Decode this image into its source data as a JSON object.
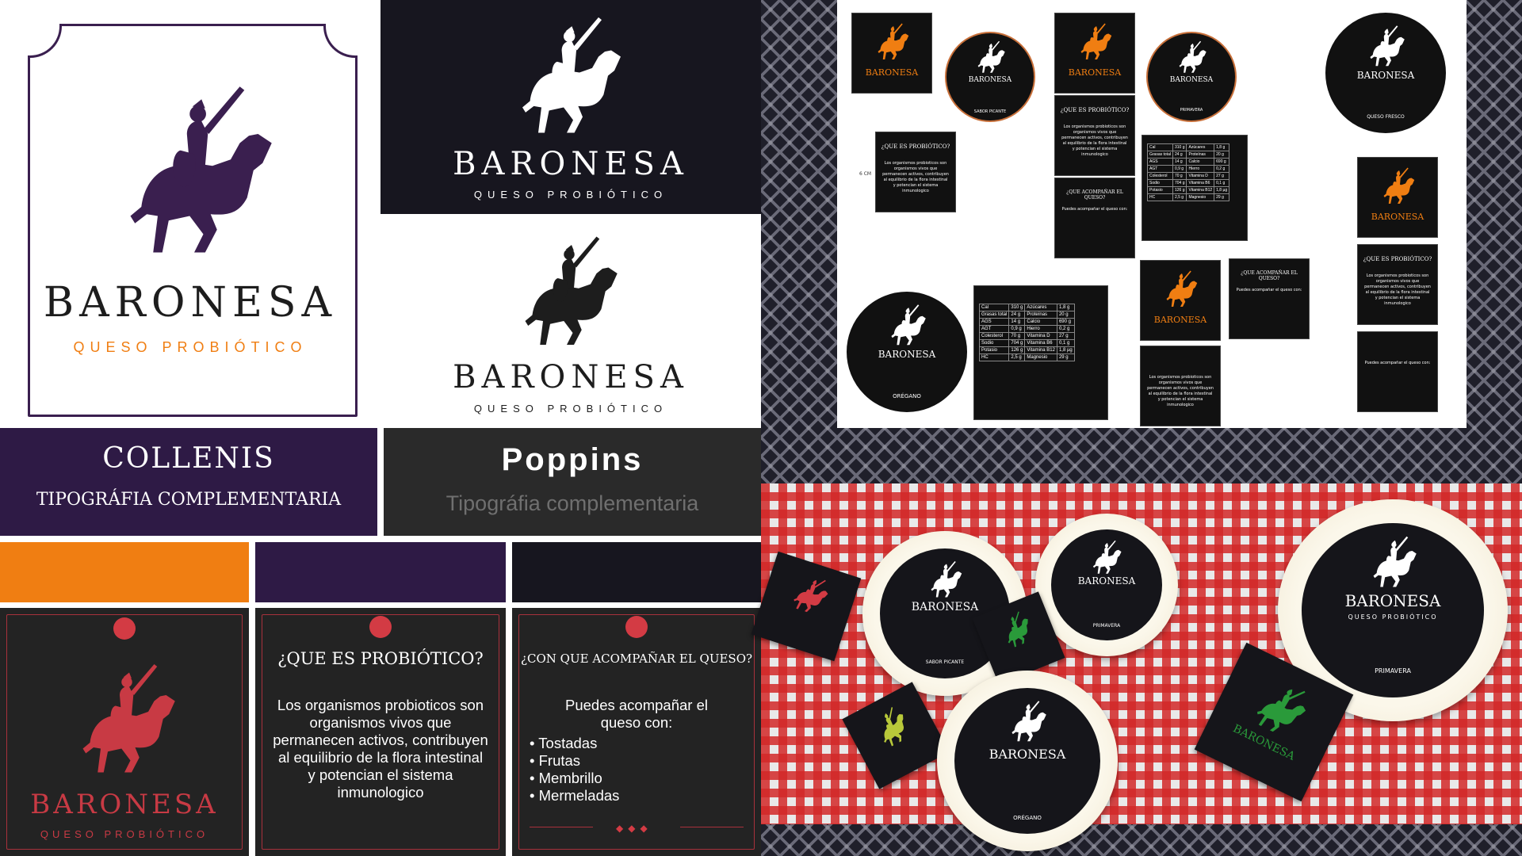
{
  "brand": {
    "name": "BARONESA",
    "tagline": "QUESO PROBIÓTICO"
  },
  "typography": {
    "collenis": {
      "name": "COLLENIS",
      "desc": "TIPOGRÁFIA COMPLEMENTARIA"
    },
    "poppins": {
      "name": "Poppins",
      "desc": "Tipográfia complementaria"
    }
  },
  "palette": [
    "#f07e12",
    "#2e1a45",
    "#17161f"
  ],
  "cards": {
    "probiotic": {
      "title": "¿QUE ES PROBIÓTICO?",
      "body": "Los organismos probioticos son organismos vivos que permanecen activos, contribuyen al equilibrio de la flora intestinal y potencian el sistema inmunologico"
    },
    "pairing": {
      "title": "¿CON QUE ACOMPAÑAR EL QUESO?",
      "intro": "Puedes acompañar el queso con:",
      "items": [
        "Tostadas",
        "Frutas",
        "Membrillo",
        "Mermeladas"
      ]
    }
  },
  "labels_sheet": {
    "flavors": [
      "SABOR PICANTE",
      "PRIMAVERA",
      "QUESO FRESCO",
      "ORÉGANO"
    ],
    "probiotic_title_small": "¿QUE ES PROBIÓTICO?",
    "pairing_title_small": "¿QUE ACOMPAÑAR EL QUESO?",
    "nutrition": [
      [
        "Cal",
        "310 g",
        "Azúcares",
        "1,8 g"
      ],
      [
        "Grasas total",
        "24 g",
        "Proteínas",
        "20 g"
      ],
      [
        "AGS",
        "14 g",
        "Calcio",
        "690 g"
      ],
      [
        "AGT",
        "0,9 g",
        "Hierro",
        "0,2 g"
      ],
      [
        "Colesterol",
        "70 g",
        "Vitamina D",
        "27 g"
      ],
      [
        "Sodio",
        "704 g",
        "Vitamina B6",
        "0,1 g"
      ],
      [
        "Potasio",
        "126 g",
        "Vitamina B12",
        "1,8 µg"
      ],
      [
        "HC",
        "2,5 g",
        "Magnesio",
        "29 g"
      ]
    ],
    "size_note": "6 CM"
  },
  "photo": {
    "cheese_labels": [
      "SABOR PICANTE",
      "PRIMAVERA",
      "ORÉGANO",
      "PRIMAVERA"
    ]
  },
  "colors": {
    "purple": "#2e1a45",
    "orange": "#f07e12",
    "dark": "#17161f",
    "red": "#d33b44"
  },
  "icons": [
    "knight-horse-logo",
    "pepper-icon",
    "leaf-icon"
  ]
}
